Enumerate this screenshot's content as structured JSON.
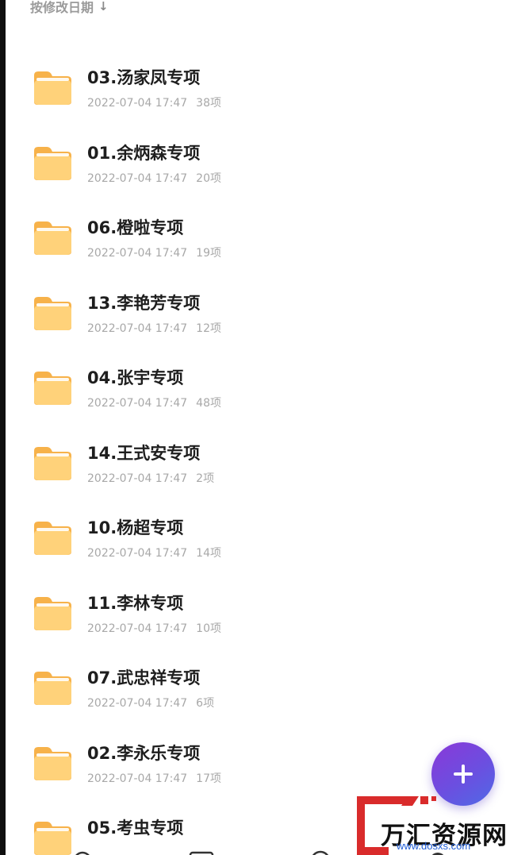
{
  "sort": {
    "label": "按修改日期",
    "arrow": "↓"
  },
  "files": [
    {
      "name": "03.汤家凤专项",
      "date": "2022-07-04 17:47",
      "count": "38项"
    },
    {
      "name": "01.余炳森专项",
      "date": "2022-07-04 17:47",
      "count": "20项"
    },
    {
      "name": "06.橙啦专项",
      "date": "2022-07-04 17:47",
      "count": "19项"
    },
    {
      "name": "13.李艳芳专项",
      "date": "2022-07-04 17:47",
      "count": "12项"
    },
    {
      "name": "04.张宇专项",
      "date": "2022-07-04 17:47",
      "count": "48项"
    },
    {
      "name": "14.王式安专项",
      "date": "2022-07-04 17:47",
      "count": "2项"
    },
    {
      "name": "10.杨超专项",
      "date": "2022-07-04 17:47",
      "count": "14项"
    },
    {
      "name": "11.李林专项",
      "date": "2022-07-04 17:47",
      "count": "10项"
    },
    {
      "name": "07.武忠祥专项",
      "date": "2022-07-04 17:47",
      "count": "6项"
    },
    {
      "name": "02.李永乐专项",
      "date": "2022-07-04 17:47",
      "count": "17项"
    },
    {
      "name": "05.考虫专项",
      "date": "",
      "count": ""
    }
  ],
  "fab": {
    "icon": "plus-icon"
  },
  "watermark": {
    "text": "万汇资源网",
    "url": "www.dosxs.com"
  },
  "colors": {
    "folder_back": "#f7b24a",
    "folder_front": "#ffd27a",
    "fab_start": "#8a38d8",
    "fab_end": "#4f6ae6"
  }
}
